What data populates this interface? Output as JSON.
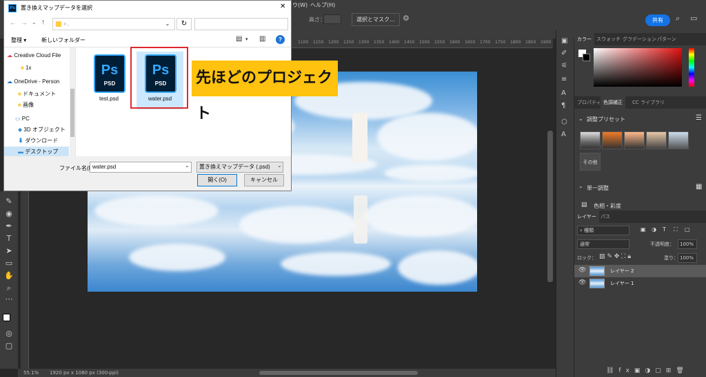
{
  "photoshop": {
    "menu_partial": "ウ(W)",
    "menu_help": "ヘルプ(H)",
    "options": {
      "height_label": "高さ：",
      "select_mask": "選択とマスク...",
      "share": "共有"
    },
    "statusbar": {
      "zoom": "55.1%",
      "doc_info": "1920 px x 1080 px (300 ppi)"
    },
    "ruler_ticks": [
      "1100",
      "1150",
      "1200",
      "1250",
      "1300",
      "1350",
      "1400",
      "1450",
      "1500",
      "1550",
      "1600",
      "1650",
      "1700",
      "1750",
      "1800",
      "1850",
      "1900"
    ],
    "color_panel": {
      "tabs": [
        "カラー",
        "スウォッチ",
        "グラデーション",
        "パターン"
      ]
    },
    "adjust_panel": {
      "tabs": [
        "プロパティ",
        "色調補正",
        "CC ライブラリ"
      ],
      "presets_label": "調整プリセット",
      "more_label": "その他",
      "single_label": "単一調整",
      "hue_label": "色相・彩度"
    },
    "layers_panel": {
      "tabs": [
        "レイヤー",
        "パス"
      ],
      "filter_kind": "種類",
      "blend_mode": "通常",
      "opacity_label": "不透明度：",
      "opacity_value": "100%",
      "lock_label": "ロック：",
      "fill_label": "塗り：",
      "fill_value": "100%",
      "layers": [
        {
          "name": "レイヤー 2"
        },
        {
          "name": "レイヤー 1"
        }
      ]
    }
  },
  "dialog": {
    "title": "置き換えマップデータを選択",
    "address_text": "› .",
    "search_placeholder": "",
    "organize": "整理 ▾",
    "new_folder": "新しいフォルダー",
    "tree": [
      {
        "label": "Creative Cloud File",
        "icon": "cloud"
      },
      {
        "label": "1x",
        "icon": "folder"
      },
      {
        "label": "OneDrive - Person",
        "icon": "cloud"
      },
      {
        "label": "ドキュメント",
        "icon": "folder"
      },
      {
        "label": "画像",
        "icon": "folder"
      },
      {
        "label": "PC",
        "icon": "pc"
      },
      {
        "label": "3D オブジェクト",
        "icon": "cube"
      },
      {
        "label": "ダウンロード",
        "icon": "download"
      },
      {
        "label": "デスクトップ",
        "icon": "desktop"
      }
    ],
    "files": [
      {
        "name": "test.psd",
        "badge": "Ps",
        "ext": "PSD"
      },
      {
        "name": "water.psd",
        "badge": "Ps",
        "ext": "PSD"
      }
    ],
    "filename_label": "ファイル名(N):",
    "filename_value": "water.psd",
    "filetype_value": "置き換えマップデータ (.psd)",
    "open_button": "開く(O)",
    "cancel_button": "キャンセル"
  },
  "callout": {
    "text": "先ほどのプロジェクト",
    "color": "#ffc20e"
  },
  "highlight_color": "#e0282e"
}
